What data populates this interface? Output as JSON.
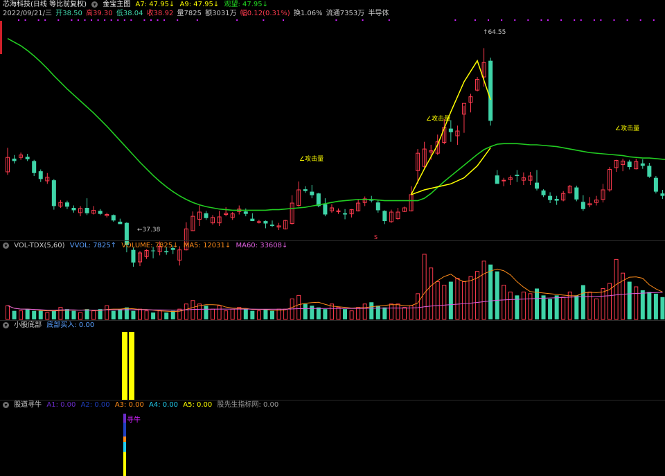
{
  "header": {
    "title": "芯海科技(日线 等比前复权)",
    "indicator_name": "金宝主图",
    "a7": "A7: 47.95↓",
    "a9": "A9: 47.95↓",
    "watch": "观望: 47.95↓"
  },
  "info": {
    "date": "2022/09/21/三",
    "open": "开38.50",
    "high": "高39.30",
    "low": "低38.04",
    "close": "收38.92",
    "volume": "量7825",
    "amount": "额3031万",
    "change": "幅0.12(0.31%)",
    "turnover": "换1.06%",
    "float": "流通7353万",
    "sector": "半导体"
  },
  "annotations": {
    "high_mark": "64.55",
    "low_mark": "37.38",
    "attack1": "∠攻击量",
    "attack2": "∠攻击量",
    "attack3": "∠攻击量",
    "attack4": "∠攻击量",
    "sell_mark": "S"
  },
  "vol_panel": {
    "name": "VOL-TDX(5,60)",
    "vvol": "VVOL: 7825↑",
    "volume": "VOLUME: 7825↓",
    "ma5": "MA5: 12031↓",
    "ma60": "MA60: 33608↓"
  },
  "bottom_panel": {
    "name": "小股底部",
    "buy": "底部买入: 0.00"
  },
  "niu_panel": {
    "name": "股道寻牛",
    "a1": "A1: 0.00",
    "a2": "A2: 0.00",
    "a3": "A3: 0.00",
    "a4": "A4: 0.00",
    "a5": "A5: 0.00",
    "pioneer": "股先生指标网: 0.00",
    "marker": "寻牛"
  },
  "colors": {
    "up": "#ff3b4e",
    "down": "#3fd4a8",
    "ma_green": "#22cc22",
    "yellow": "#ffff00",
    "magenta": "#d020ff"
  },
  "chart_data": {
    "type": "candlestick",
    "price_range": [
      35,
      68
    ],
    "candles": [
      {
        "o": 44.0,
        "h": 48.0,
        "l": 43.5,
        "c": 46.4
      },
      {
        "o": 46.2,
        "h": 46.8,
        "l": 45.4,
        "c": 45.8
      },
      {
        "o": 46.4,
        "h": 47.2,
        "l": 46.0,
        "c": 46.8
      },
      {
        "o": 46.5,
        "h": 47.0,
        "l": 45.8,
        "c": 46.1
      },
      {
        "o": 45.8,
        "h": 46.0,
        "l": 43.3,
        "c": 43.8
      },
      {
        "o": 44.1,
        "h": 44.4,
        "l": 42.3,
        "c": 42.8
      },
      {
        "o": 42.5,
        "h": 43.8,
        "l": 42.0,
        "c": 43.1
      },
      {
        "o": 42.6,
        "h": 42.8,
        "l": 37.7,
        "c": 38.3
      },
      {
        "o": 38.3,
        "h": 39.3,
        "l": 38.0,
        "c": 38.9
      },
      {
        "o": 38.9,
        "h": 39.2,
        "l": 37.8,
        "c": 38.2
      },
      {
        "o": 38.0,
        "h": 38.4,
        "l": 37.2,
        "c": 37.6
      },
      {
        "o": 37.2,
        "h": 38.3,
        "l": 36.6,
        "c": 37.9
      },
      {
        "o": 38.0,
        "h": 39.6,
        "l": 36.8,
        "c": 37.1
      },
      {
        "o": 37.1,
        "h": 38.3,
        "l": 36.9,
        "c": 37.6
      },
      {
        "o": 37.5,
        "h": 37.8,
        "l": 36.8,
        "c": 37.0
      },
      {
        "o": 36.7,
        "h": 37.2,
        "l": 36.4,
        "c": 36.9
      },
      {
        "o": 36.8,
        "h": 36.9,
        "l": 35.7,
        "c": 35.9
      },
      {
        "o": 35.7,
        "h": 36.2,
        "l": 35.4,
        "c": 35.3
      },
      {
        "o": 35.5,
        "h": 35.6,
        "l": 30.6,
        "c": 31.8
      },
      {
        "o": 31.0,
        "h": 31.4,
        "l": 28.2,
        "c": 28.9
      },
      {
        "o": 29.0,
        "h": 30.8,
        "l": 28.3,
        "c": 30.5
      },
      {
        "o": 29.9,
        "h": 31.1,
        "l": 29.5,
        "c": 30.9
      },
      {
        "o": 30.9,
        "h": 31.5,
        "l": 29.6,
        "c": 30.8
      },
      {
        "o": 30.7,
        "h": 32.4,
        "l": 30.1,
        "c": 31.6
      },
      {
        "o": 30.8,
        "h": 31.5,
        "l": 30.2,
        "c": 30.6
      },
      {
        "o": 31.3,
        "h": 31.7,
        "l": 30.3,
        "c": 31.0
      },
      {
        "o": 29.3,
        "h": 31.6,
        "l": 28.4,
        "c": 31.0
      },
      {
        "o": 31.0,
        "h": 35.6,
        "l": 30.9,
        "c": 34.5
      },
      {
        "o": 34.2,
        "h": 37.4,
        "l": 34.2,
        "c": 36.6
      },
      {
        "o": 36.1,
        "h": 38.4,
        "l": 35.0,
        "c": 37.3
      },
      {
        "o": 37.1,
        "h": 37.5,
        "l": 36.0,
        "c": 36.3
      },
      {
        "o": 35.5,
        "h": 36.8,
        "l": 35.2,
        "c": 36.4
      },
      {
        "o": 35.5,
        "h": 37.5,
        "l": 35.0,
        "c": 36.5
      },
      {
        "o": 36.9,
        "h": 38.1,
        "l": 36.6,
        "c": 37.1
      },
      {
        "o": 36.4,
        "h": 37.3,
        "l": 36.0,
        "c": 37.0
      },
      {
        "o": 37.4,
        "h": 38.4,
        "l": 36.9,
        "c": 37.8
      },
      {
        "o": 37.4,
        "h": 37.9,
        "l": 36.6,
        "c": 37.0
      },
      {
        "o": 36.2,
        "h": 37.1,
        "l": 35.8,
        "c": 35.8
      },
      {
        "o": 35.6,
        "h": 36.0,
        "l": 35.4,
        "c": 35.7
      },
      {
        "o": 35.8,
        "h": 35.9,
        "l": 34.6,
        "c": 35.4
      },
      {
        "o": 35.2,
        "h": 35.9,
        "l": 34.8,
        "c": 35.0
      },
      {
        "o": 34.8,
        "h": 35.5,
        "l": 34.3,
        "c": 35.0
      },
      {
        "o": 34.5,
        "h": 36.0,
        "l": 34.4,
        "c": 35.9
      },
      {
        "o": 35.4,
        "h": 40.1,
        "l": 35.2,
        "c": 38.8
      },
      {
        "o": 38.4,
        "h": 42.4,
        "l": 38.2,
        "c": 41.0
      },
      {
        "o": 41.1,
        "h": 41.6,
        "l": 40.5,
        "c": 40.8
      },
      {
        "o": 40.7,
        "h": 41.8,
        "l": 39.6,
        "c": 40.1
      },
      {
        "o": 40.4,
        "h": 40.5,
        "l": 38.1,
        "c": 38.3
      },
      {
        "o": 38.6,
        "h": 39.6,
        "l": 36.6,
        "c": 36.9
      },
      {
        "o": 37.5,
        "h": 38.6,
        "l": 37.2,
        "c": 38.0
      },
      {
        "o": 37.4,
        "h": 37.9,
        "l": 37.0,
        "c": 37.5
      },
      {
        "o": 37.1,
        "h": 37.8,
        "l": 36.1,
        "c": 36.9
      },
      {
        "o": 37.0,
        "h": 37.8,
        "l": 36.4,
        "c": 37.7
      },
      {
        "o": 37.5,
        "h": 39.4,
        "l": 37.4,
        "c": 38.8
      },
      {
        "o": 38.9,
        "h": 39.9,
        "l": 38.3,
        "c": 39.5
      },
      {
        "o": 39.4,
        "h": 40.0,
        "l": 38.9,
        "c": 39.2
      },
      {
        "o": 38.9,
        "h": 39.3,
        "l": 37.2,
        "c": 37.6
      },
      {
        "o": 37.5,
        "h": 37.6,
        "l": 35.3,
        "c": 35.8
      },
      {
        "o": 35.7,
        "h": 37.7,
        "l": 35.5,
        "c": 37.3
      },
      {
        "o": 36.2,
        "h": 38.0,
        "l": 36.0,
        "c": 37.3
      },
      {
        "o": 37.4,
        "h": 38.2,
        "l": 37.3,
        "c": 38.0
      },
      {
        "o": 37.5,
        "h": 41.6,
        "l": 37.4,
        "c": 40.2
      },
      {
        "o": 44.2,
        "h": 47.8,
        "l": 42.0,
        "c": 47.1
      },
      {
        "o": 44.9,
        "h": 49.0,
        "l": 44.6,
        "c": 47.8
      },
      {
        "o": 47.3,
        "h": 48.5,
        "l": 46.0,
        "c": 47.5
      },
      {
        "o": 47.1,
        "h": 50.2,
        "l": 46.8,
        "c": 49.0
      },
      {
        "o": 48.9,
        "h": 52.8,
        "l": 48.6,
        "c": 51.4
      },
      {
        "o": 51.2,
        "h": 52.6,
        "l": 49.0,
        "c": 50.6
      },
      {
        "o": 50.0,
        "h": 51.7,
        "l": 48.5,
        "c": 50.8
      },
      {
        "o": 53.6,
        "h": 55.0,
        "l": 50.5,
        "c": 55.4
      },
      {
        "o": 55.6,
        "h": 57.0,
        "l": 53.9,
        "c": 56.5
      },
      {
        "o": 57.6,
        "h": 59.8,
        "l": 57.4,
        "c": 59.4
      },
      {
        "o": 59.8,
        "h": 64.6,
        "l": 58.2,
        "c": 62.2
      },
      {
        "o": 62.5,
        "h": 63.0,
        "l": 51.7,
        "c": 52.5
      },
      {
        "o": 43.4,
        "h": 44.3,
        "l": 42.1,
        "c": 42.0
      },
      {
        "o": 42.5,
        "h": 43.0,
        "l": 41.6,
        "c": 42.6
      },
      {
        "o": 42.7,
        "h": 43.4,
        "l": 41.8,
        "c": 43.0
      },
      {
        "o": 43.5,
        "h": 44.3,
        "l": 42.3,
        "c": 43.3
      },
      {
        "o": 42.6,
        "h": 43.9,
        "l": 41.8,
        "c": 43.0
      },
      {
        "o": 42.6,
        "h": 44.0,
        "l": 41.8,
        "c": 43.3
      },
      {
        "o": 42.2,
        "h": 44.3,
        "l": 40.9,
        "c": 41.2
      },
      {
        "o": 40.9,
        "h": 41.1,
        "l": 39.8,
        "c": 40.1
      },
      {
        "o": 40.0,
        "h": 40.6,
        "l": 38.8,
        "c": 39.3
      },
      {
        "o": 39.5,
        "h": 40.0,
        "l": 38.5,
        "c": 39.2
      },
      {
        "o": 39.3,
        "h": 40.8,
        "l": 39.1,
        "c": 40.4
      },
      {
        "o": 40.5,
        "h": 41.8,
        "l": 40.4,
        "c": 41.6
      },
      {
        "o": 41.4,
        "h": 41.7,
        "l": 39.1,
        "c": 39.4
      },
      {
        "o": 39.0,
        "h": 40.1,
        "l": 37.5,
        "c": 37.8
      },
      {
        "o": 38.5,
        "h": 39.8,
        "l": 38.1,
        "c": 38.7
      },
      {
        "o": 38.9,
        "h": 40.0,
        "l": 38.4,
        "c": 39.3
      },
      {
        "o": 39.4,
        "h": 42.0,
        "l": 38.9,
        "c": 41.0
      },
      {
        "o": 41.0,
        "h": 44.8,
        "l": 40.7,
        "c": 44.4
      },
      {
        "o": 44.7,
        "h": 46.0,
        "l": 44.0,
        "c": 45.9
      },
      {
        "o": 45.2,
        "h": 46.2,
        "l": 44.1,
        "c": 45.8
      },
      {
        "o": 45.7,
        "h": 46.0,
        "l": 44.4,
        "c": 44.8
      },
      {
        "o": 44.5,
        "h": 46.2,
        "l": 44.4,
        "c": 45.7
      },
      {
        "o": 45.4,
        "h": 46.1,
        "l": 44.5,
        "c": 45.0
      },
      {
        "o": 45.0,
        "h": 45.5,
        "l": 43.0,
        "c": 43.2
      },
      {
        "o": 43.0,
        "h": 43.3,
        "l": 40.4,
        "c": 40.7
      },
      {
        "o": 40.4,
        "h": 41.0,
        "l": 39.5,
        "c": 40.0
      }
    ],
    "ma_line": [
      66.2,
      65.6,
      65.0,
      64.2,
      63.3,
      62.3,
      61.2,
      60.0,
      58.9,
      57.8,
      56.8,
      55.8,
      54.8,
      53.8,
      52.7,
      51.6,
      50.4,
      49.2,
      48.0,
      46.8,
      45.6,
      44.5,
      43.4,
      42.4,
      41.5,
      40.7,
      40.0,
      39.4,
      38.9,
      38.5,
      38.2,
      38.0,
      37.8,
      37.7,
      37.6,
      37.6,
      37.6,
      37.6,
      37.6,
      37.6,
      37.7,
      37.7,
      37.8,
      37.9,
      38.0,
      38.1,
      38.3,
      38.5,
      38.7,
      38.9,
      39.1,
      39.2,
      39.3,
      39.4,
      39.4,
      39.4,
      39.3,
      39.2,
      39.2,
      39.2,
      39.2,
      39.2,
      39.2,
      39.6,
      40.4,
      41.4,
      42.4,
      43.3,
      44.2,
      45.1,
      46.0,
      46.9,
      47.7,
      48.2,
      48.6,
      48.7,
      48.7,
      48.7,
      48.6,
      48.5,
      48.5,
      48.4,
      48.3,
      48.2,
      48.0,
      47.8,
      47.6,
      47.4,
      47.2,
      47.1,
      47.0,
      46.9,
      46.8,
      46.7,
      46.5,
      46.4,
      46.3,
      46.3,
      46.2,
      46.1,
      46.0
    ],
    "yellow_upper": [
      40.2,
      44.5,
      48.5,
      54.0,
      59.0,
      62.5,
      56.0
    ],
    "yellow_lower": [
      40.2,
      41.0,
      41.5,
      42.0,
      43.0,
      45.0,
      48.0
    ],
    "volume": [
      8,
      5,
      5,
      6,
      5,
      5,
      4,
      5,
      7,
      6,
      5,
      4,
      6,
      5,
      6,
      8,
      5,
      6,
      7,
      5,
      6,
      5,
      4,
      5,
      4,
      5,
      6,
      9,
      11,
      9,
      8,
      6,
      8,
      5,
      6,
      7,
      6,
      5,
      5,
      6,
      5,
      6,
      6,
      12,
      14,
      9,
      8,
      7,
      6,
      9,
      7,
      6,
      5,
      7,
      9,
      10,
      8,
      7,
      9,
      9,
      7,
      8,
      15,
      38,
      30,
      22,
      20,
      22,
      24,
      22,
      25,
      28,
      34,
      32,
      28,
      20,
      16,
      14,
      16,
      15,
      18,
      14,
      12,
      14,
      13,
      16,
      14,
      20,
      16,
      12,
      18,
      21,
      35,
      27,
      22,
      19,
      17,
      16,
      15,
      13
    ]
  }
}
